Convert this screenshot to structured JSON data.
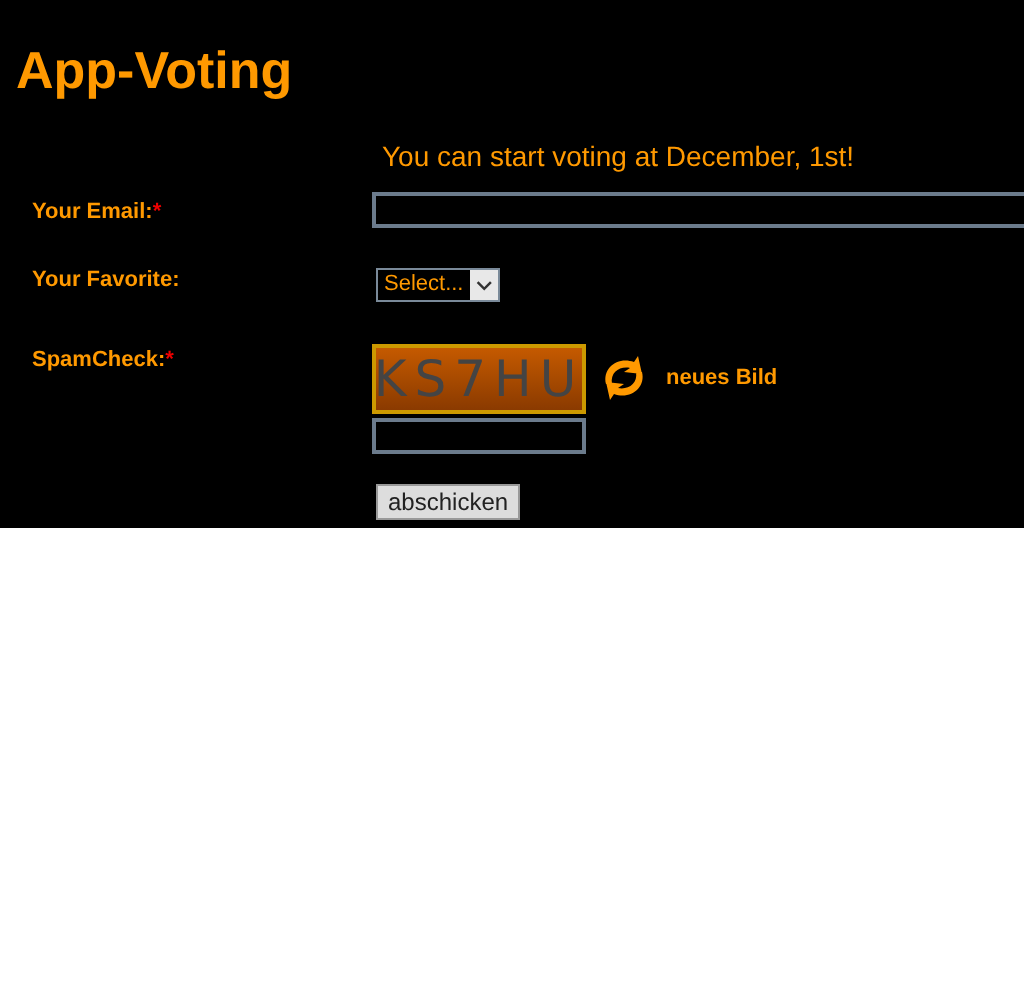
{
  "title": "App-Voting",
  "notice": "You can start voting at December, 1st!",
  "fields": [
    {
      "kind": "text",
      "label": "Your Email:",
      "required": true
    },
    {
      "kind": "select",
      "label": "Your Favorite:",
      "required": false,
      "value": "Select..."
    },
    {
      "kind": "captcha",
      "label": "SpamCheck:",
      "required": true,
      "captcha_text": "KS7HU",
      "refresh_label": "neues Bild"
    }
  ],
  "required_mark": "*",
  "submit": "abschicken"
}
